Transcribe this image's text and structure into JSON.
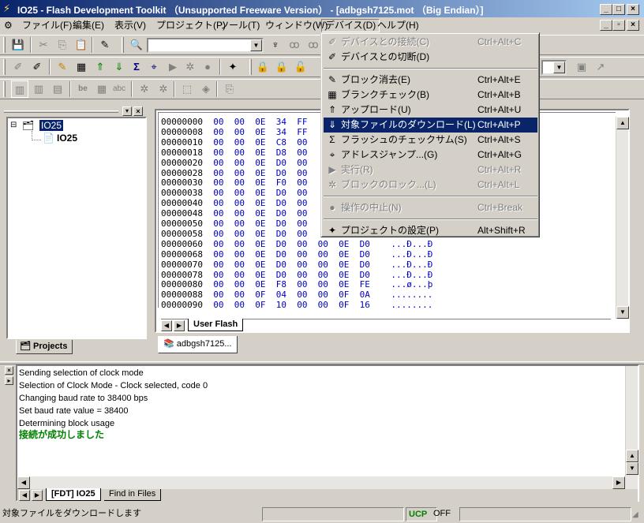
{
  "window": {
    "title": "IO25 - Flash Development Toolkit （Unsupported Freeware Version） - [adbgsh7125.mot （Big Endian）]",
    "controls": [
      "_",
      "□",
      "×"
    ],
    "doc_controls": [
      "_",
      "▫",
      "×"
    ]
  },
  "menubar": {
    "items": [
      "ファイル(F)",
      "編集(E)",
      "表示(V)",
      "プロジェクト(P)",
      "ツール(T)",
      "ウィンドウ(W)",
      "デバイス(D)",
      "ヘルプ(H)"
    ]
  },
  "device_menu": {
    "items": [
      {
        "label": "デバイスとの接続(C)",
        "shortcut": "Ctrl+Alt+C",
        "enabled": false,
        "icon": "connect-icon"
      },
      {
        "label": "デバイスとの切断(D)",
        "shortcut": "",
        "enabled": true,
        "icon": "disconnect-icon"
      },
      {
        "separator": true
      },
      {
        "label": "ブロック消去(E)",
        "shortcut": "Ctrl+Alt+E",
        "enabled": true,
        "icon": "erase-icon"
      },
      {
        "label": "ブランクチェック(B)",
        "shortcut": "Ctrl+Alt+B",
        "enabled": true,
        "icon": "blank-check-icon"
      },
      {
        "label": "アップロード(U)",
        "shortcut": "Ctrl+Alt+U",
        "enabled": true,
        "icon": "upload-icon"
      },
      {
        "label": "対象ファイルのダウンロード(L)",
        "shortcut": "Ctrl+Alt+P",
        "enabled": true,
        "selected": true,
        "icon": "download-icon"
      },
      {
        "label": "フラッシュのチェックサム(S)",
        "shortcut": "Ctrl+Alt+S",
        "enabled": true,
        "icon": "checksum-icon"
      },
      {
        "label": "アドレスジャンプ...(G)",
        "shortcut": "Ctrl+Alt+G",
        "enabled": true,
        "icon": "goto-address-icon"
      },
      {
        "label": "実行(R)",
        "shortcut": "Ctrl+Alt+R",
        "enabled": false,
        "icon": "run-icon"
      },
      {
        "label": "ブロックのロック...(L)",
        "shortcut": "Ctrl+Alt+L",
        "enabled": false,
        "icon": "lock-icon"
      },
      {
        "separator": true
      },
      {
        "label": "操作の中止(N)",
        "shortcut": "Ctrl+Break",
        "enabled": false,
        "icon": "stop-icon"
      },
      {
        "separator": true
      },
      {
        "label": "プロジェクトの設定(P)",
        "shortcut": "Alt+Shift+R",
        "enabled": true,
        "icon": "project-settings-icon"
      }
    ]
  },
  "workspace": {
    "root": "IO25",
    "child": "IO25",
    "tab": "Projects"
  },
  "hexview": {
    "rows": [
      {
        "addr": "00000000",
        "bytes": "00  00  0E  34  FF",
        "ascii": ""
      },
      {
        "addr": "00000008",
        "bytes": "00  00  0E  34  FF",
        "ascii": ""
      },
      {
        "addr": "00000010",
        "bytes": "00  00  0E  C8  00",
        "ascii": ""
      },
      {
        "addr": "00000018",
        "bytes": "00  00  0E  D8  00",
        "ascii": ""
      },
      {
        "addr": "00000020",
        "bytes": "00  00  0E  D0  00",
        "ascii": ""
      },
      {
        "addr": "00000028",
        "bytes": "00  00  0E  D0  00",
        "ascii": ""
      },
      {
        "addr": "00000030",
        "bytes": "00  00  0E  F0  00",
        "ascii": ""
      },
      {
        "addr": "00000038",
        "bytes": "00  00  0E  D0  00",
        "ascii": ""
      },
      {
        "addr": "00000040",
        "bytes": "00  00  0E  D0  00",
        "ascii": ""
      },
      {
        "addr": "00000048",
        "bytes": "00  00  0E  D0  00",
        "ascii": ""
      },
      {
        "addr": "00000050",
        "bytes": "00  00  0E  D0  00",
        "ascii": ""
      },
      {
        "addr": "00000058",
        "bytes": "00  00  0E  D0  00",
        "ascii": ""
      },
      {
        "addr": "00000060",
        "bytes": "00  00  0E  D0  00  00  0E  D0",
        "ascii": "...Ð...Ð"
      },
      {
        "addr": "00000068",
        "bytes": "00  00  0E  D0  00  00  0E  D0",
        "ascii": "...Ð...Ð"
      },
      {
        "addr": "00000070",
        "bytes": "00  00  0E  D0  00  00  0E  D0",
        "ascii": "...Ð...Ð"
      },
      {
        "addr": "00000078",
        "bytes": "00  00  0E  D0  00  00  0E  D0",
        "ascii": "...Ð...Ð"
      },
      {
        "addr": "00000080",
        "bytes": "00  00  0E  F8  00  00  0E  FE",
        "ascii": "...ø...þ"
      },
      {
        "addr": "00000088",
        "bytes": "00  00  0F  04  00  00  0F  0A",
        "ascii": "........"
      },
      {
        "addr": "00000090",
        "bytes": "00  00  0F  10  00  00  0F  16",
        "ascii": "........"
      }
    ],
    "tab": "User Flash",
    "doc_tab": "adbgsh7125..."
  },
  "output": {
    "lines": [
      "Sending selection of clock mode",
      "Selection of Clock Mode - Clock selected, code 0",
      "Changing baud rate to 38400 bps",
      "Set baud rate value = 38400",
      "Determining block usage"
    ],
    "success": "接続が成功しました",
    "tabs": [
      "[FDT] IO25",
      "Find in Files"
    ]
  },
  "status": {
    "message": "対象ファイルをダウンロードします",
    "ucp": "UCP",
    "ovr": "OFF"
  },
  "colors": {
    "title_start": "#0a246a",
    "title_end": "#a6caf0",
    "selection": "#0a246a",
    "hex_blue": "#0000c0",
    "success_green": "#008000"
  }
}
